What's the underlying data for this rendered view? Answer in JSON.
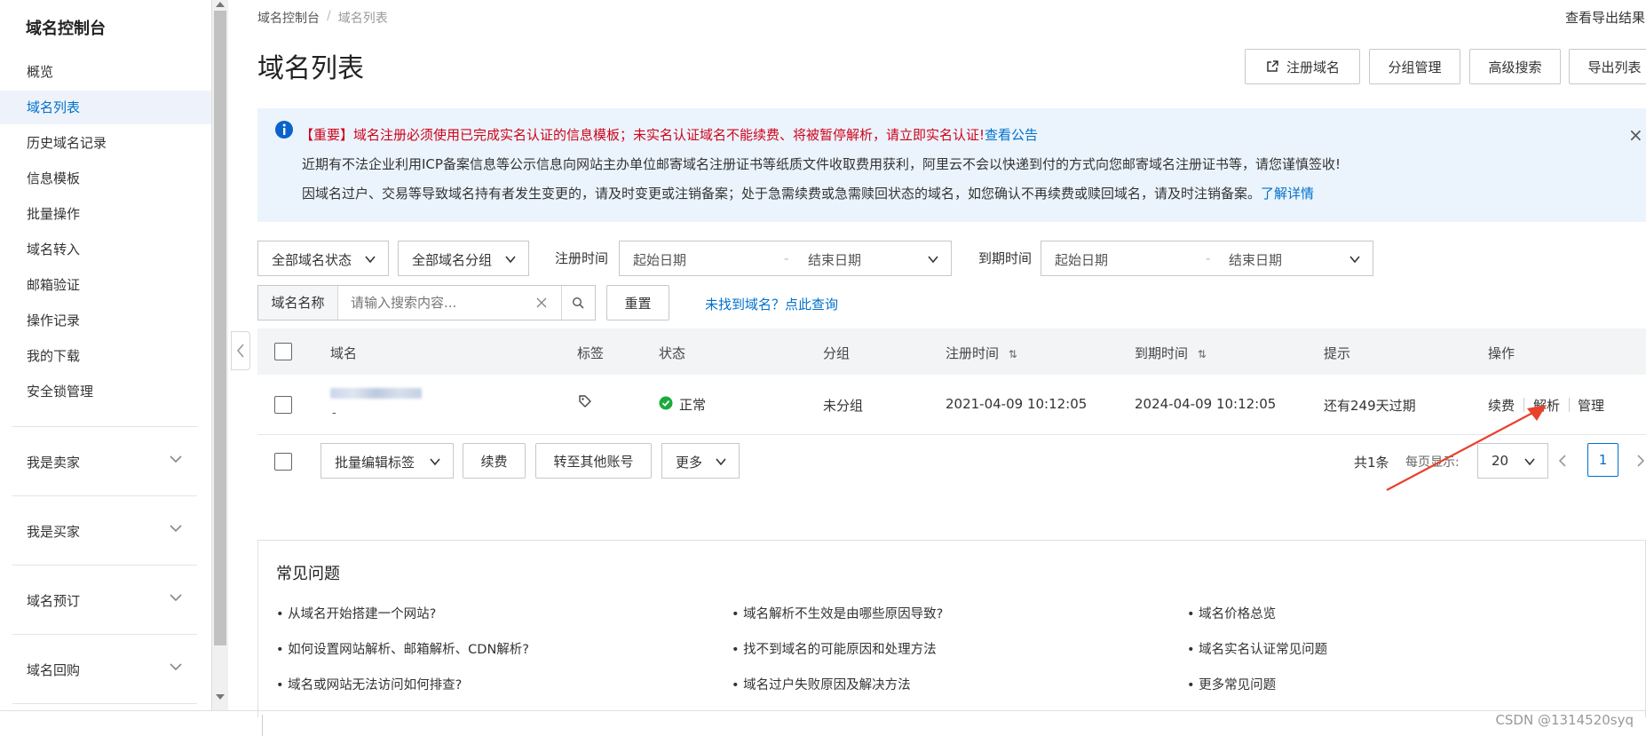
{
  "sidebar": {
    "title": "域名控制台",
    "items": [
      {
        "label": "概览"
      },
      {
        "label": "域名列表"
      },
      {
        "label": "历史域名记录"
      },
      {
        "label": "信息模板"
      },
      {
        "label": "批量操作"
      },
      {
        "label": "域名转入"
      },
      {
        "label": "邮箱验证"
      },
      {
        "label": "操作记录"
      },
      {
        "label": "我的下载"
      },
      {
        "label": "安全锁管理"
      }
    ],
    "groups": [
      {
        "label": "我是卖家"
      },
      {
        "label": "我是买家"
      },
      {
        "label": "域名预订"
      },
      {
        "label": "域名回购"
      }
    ]
  },
  "breadcrumb": {
    "root": "域名控制台",
    "sep": "/",
    "current": "域名列表"
  },
  "top_right_link": "查看导出结果",
  "page_title": "域名列表",
  "header_buttons": {
    "register": "注册域名",
    "group_manage": "分组管理",
    "advanced_search": "高级搜索",
    "export": "导出列表"
  },
  "notice": {
    "important_prefix": "【重要】",
    "important_text": "域名注册必须使用已完成实名认证的信息模板；未实名认证域名不能续费、将被暂停解析，请立即实名认证!",
    "important_link": "查看公告",
    "line2": "近期有不法企业利用ICP备案信息等公示信息向网站主办单位邮寄域名注册证书等纸质文件收取费用获利，阿里云不会以快递到付的方式向您邮寄域名注册证书等，请您谨慎签收!",
    "line3": "因域名过户、交易等导致域名持有者发生变更的，请及时变更或注销备案；处于急需续费或急需赎回状态的域名，如您确认不再续费或赎回域名，请及时注销备案。",
    "line3_link": "了解详情",
    "close": "×"
  },
  "filters": {
    "status_select": "全部域名状态",
    "group_select": "全部域名分组",
    "reg_time_label": "注册时间",
    "reg_start": "起始日期",
    "reg_dash": "-",
    "reg_end": "结束日期",
    "exp_time_label": "到期时间",
    "exp_start": "起始日期",
    "exp_dash": "-",
    "exp_end": "结束日期",
    "name_label": "域名名称",
    "search_placeholder": "请输入搜索内容...",
    "reset": "重置",
    "not_found_link": "未找到域名？点此查询"
  },
  "table": {
    "headers": {
      "domain": "域名",
      "tag": "标签",
      "status": "状态",
      "group": "分组",
      "reg_time": "注册时间",
      "exp_time": "到期时间",
      "hint": "提示",
      "ops": "操作"
    },
    "sort_icon": "⇅",
    "rows": [
      {
        "domain_sub": "-",
        "status": "正常",
        "group": "未分组",
        "reg_time": "2021-04-09 10:12:05",
        "exp_time": "2024-04-09 10:12:05",
        "hint": "还有249天过期",
        "op_renew": "续费",
        "op_resolve": "解析",
        "op_manage": "管理"
      }
    ]
  },
  "batch": {
    "edit_tags": "批量编辑标签",
    "renew": "续费",
    "transfer": "转至其他账号",
    "more": "更多"
  },
  "pagination": {
    "total": "共1条",
    "per_page_label": "每页显示:",
    "per_page": "20",
    "current_page": "1"
  },
  "faq": {
    "title": "常见问题",
    "items": [
      "• 从域名开始搭建一个网站?",
      "• 域名解析不生效是由哪些原因导致?",
      "• 域名价格总览",
      "• 如何设置网站解析、邮箱解析、CDN解析?",
      "• 找不到域名的可能原因和处理方法",
      "• 域名实名认证常见问题",
      "• 域名或网站无法访问如何排查?",
      "• 域名过户失败原因及解决方法",
      "• 更多常见问题"
    ]
  },
  "watermark": "CSDN @1314520syq",
  "colors": {
    "accent": "#0070cc",
    "danger": "#d0021b",
    "success": "#1aab3c",
    "arrow": "#e8412c"
  }
}
